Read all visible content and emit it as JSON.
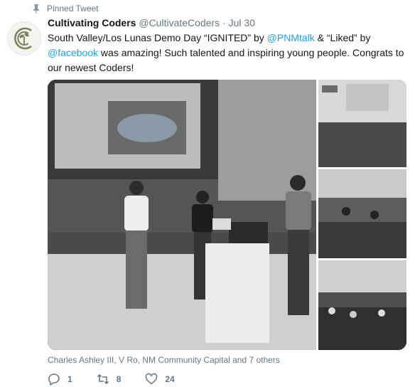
{
  "pinned_label": "Pinned Tweet",
  "author": {
    "name": "Cultivating Coders",
    "handle": "@CultivateCoders",
    "date": "Jul 30"
  },
  "tweet": {
    "part1": "South Valley/Los Lunas Demo Day “IGNITED” by ",
    "mention1": "@PNMtalk",
    "part2": " & “Liked” by ",
    "mention2": "@facebook",
    "part3": " was amazing! Such talented and inspiring young people. Congrats to our newest Coders!"
  },
  "likers": "Charles Ashley III, V Ro, NM Community Capital and 7 others",
  "actions": {
    "reply_count": "1",
    "retweet_count": "8",
    "like_count": "24"
  },
  "colors": {
    "link": "#1da1f2",
    "muted": "#657786",
    "avatar_logo": "#7a7f5e"
  }
}
